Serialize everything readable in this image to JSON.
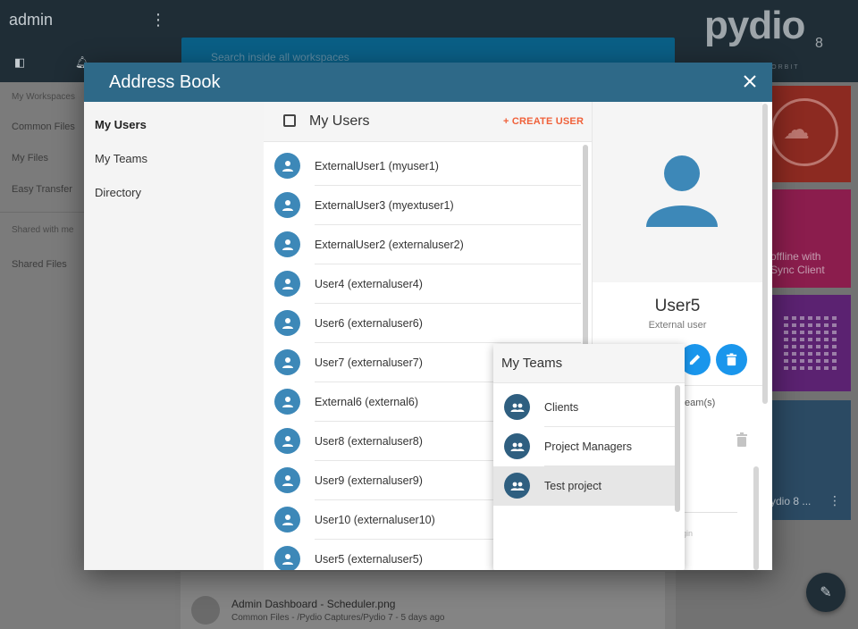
{
  "background": {
    "sidebar": {
      "title": "admin",
      "sections": [
        {
          "label": "My Workspaces"
        },
        {
          "label": "Shared with me"
        }
      ],
      "items": [
        {
          "label": "Common Files"
        },
        {
          "label": "My Files"
        },
        {
          "label": "Easy Transfer"
        },
        {
          "label": "Shared Files"
        }
      ]
    },
    "search_placeholder": "Search inside all workspaces",
    "logo": {
      "text": "pydio",
      "version": "8",
      "tagline": "A IN ORBIT"
    },
    "tiles": {
      "sync_text_line1": "offline with",
      "sync_text_line2": "Sync Client",
      "doc_text": "ydio 8 ..."
    },
    "recent_file": {
      "name": "Admin Dashboard - Scheduler.png",
      "path": "Common Files - /Pydio Captures/Pydio 7 - 5 days ago"
    }
  },
  "modal": {
    "title": "Address Book",
    "nav": [
      {
        "label": "My Users",
        "active": true
      },
      {
        "label": "My Teams",
        "active": false
      },
      {
        "label": "Directory",
        "active": false
      }
    ],
    "list": {
      "title": "My Users",
      "create_label": "+ CREATE USER",
      "users": [
        {
          "label": "ExternalUser1 (myuser1)"
        },
        {
          "label": "ExternalUser3 (myextuser1)"
        },
        {
          "label": "ExternalUser2 (externaluser2)"
        },
        {
          "label": "User4 (externaluser4)"
        },
        {
          "label": "User6 (externaluser6)"
        },
        {
          "label": "User7 (externaluser7)"
        },
        {
          "label": "External6 (external6)"
        },
        {
          "label": "User8 (externaluser8)"
        },
        {
          "label": "User9 (externaluser9)"
        },
        {
          "label": "User10 (externaluser10)"
        },
        {
          "label": "User5 (externaluser5)"
        }
      ]
    },
    "detail": {
      "name": "User5",
      "subtitle": "External user",
      "teams_label": "team(s)",
      "faint_text": "gin"
    },
    "teams_popover": {
      "title": "My Teams",
      "teams": [
        {
          "label": "Clients",
          "selected": false
        },
        {
          "label": "Project Managers",
          "selected": false
        },
        {
          "label": "Test project",
          "selected": true
        }
      ]
    }
  },
  "colors": {
    "header": "#2e6988",
    "accent_orange": "#f0613a",
    "avatar_blue": "#3d88b8",
    "button_blue": "#1a96ec"
  },
  "icons": {
    "close": "close-icon",
    "user": "user-icon",
    "team": "team-icon",
    "edit": "pencil-icon",
    "delete": "trash-icon"
  }
}
